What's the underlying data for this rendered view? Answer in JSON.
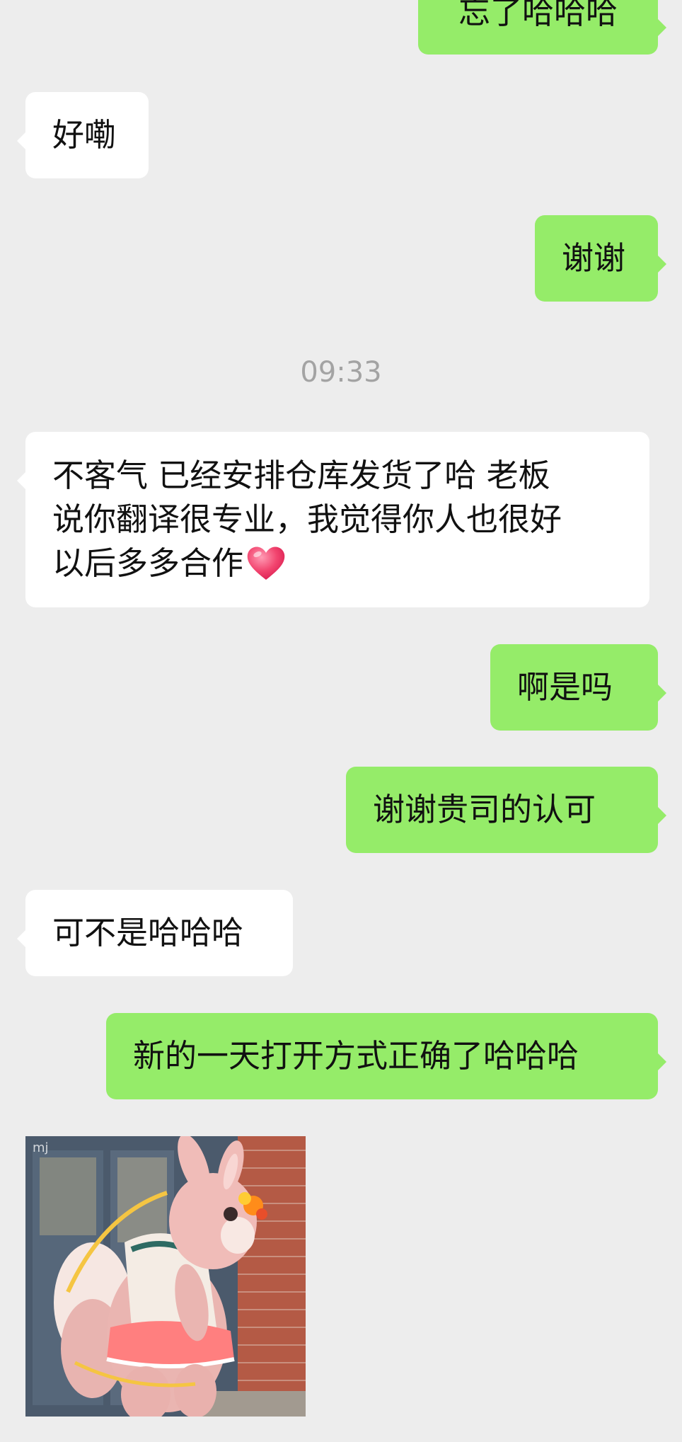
{
  "messages": [
    {
      "id": "m0",
      "side": "sent",
      "text": "忘了哈哈哈"
    },
    {
      "id": "m1",
      "side": "received",
      "text": "好嘞"
    },
    {
      "id": "m2",
      "side": "sent",
      "text": "谢谢"
    },
    {
      "id": "m3",
      "side": "received",
      "lines": [
        "不客气 已经安排仓库发货了哈 老板",
        "说你翻译很专业，我觉得你人也很好",
        "以后多多合作"
      ],
      "emoji": "heart-emoji"
    },
    {
      "id": "m4",
      "side": "sent",
      "text": "啊是吗"
    },
    {
      "id": "m5",
      "side": "sent",
      "text": "谢谢贵司的认可"
    },
    {
      "id": "m6",
      "side": "received",
      "text": "可不是哈哈哈"
    },
    {
      "id": "m7",
      "side": "sent",
      "text": "新的一天打开方式正确了哈哈哈"
    }
  ],
  "timestamp": "09:33",
  "sticker": {
    "icon": "pink-fox-mascot-sticker",
    "watermark": "mj"
  },
  "colors": {
    "background": "#ededed",
    "sent_bubble": "#95ec69",
    "received_bubble": "#ffffff",
    "timestamp_text": "#a3a3a3"
  }
}
